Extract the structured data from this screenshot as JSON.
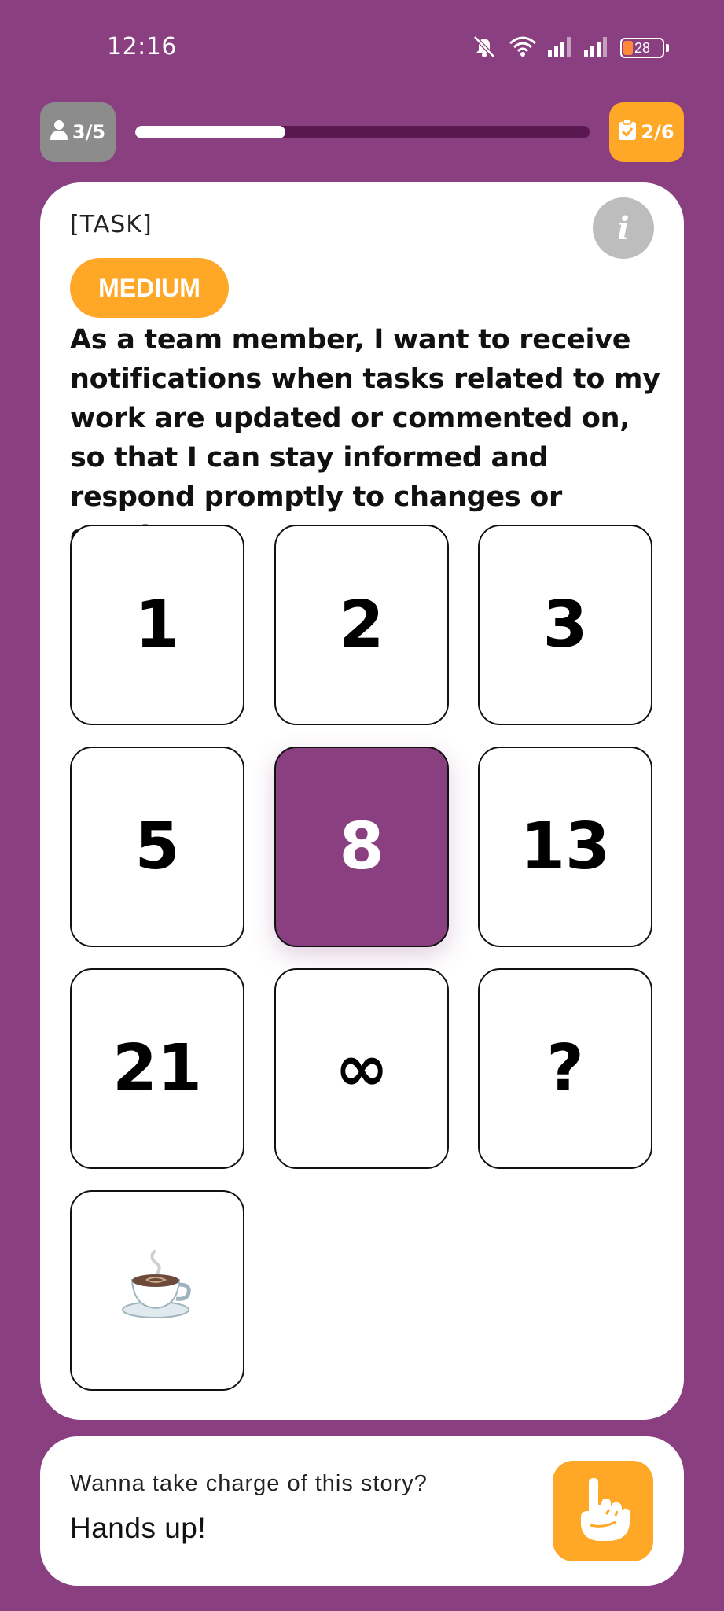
{
  "status_bar": {
    "time": "12:16",
    "battery_level": "28",
    "icons": [
      "mute-icon",
      "wifi-icon",
      "signal-icon",
      "signal-icon",
      "battery-icon"
    ]
  },
  "progress": {
    "players_label": "3/5",
    "tasks_label": "2/6",
    "fill_fraction": 0.33
  },
  "task": {
    "label": "[TASK]",
    "difficulty": "MEDIUM",
    "story": "As a team member, I want to receive notifications when tasks related to my work are updated or commented on, so that I can stay informed and respond promptly to changes or queries."
  },
  "cards": [
    {
      "value": "1",
      "selected": false
    },
    {
      "value": "2",
      "selected": false
    },
    {
      "value": "3",
      "selected": false
    },
    {
      "value": "5",
      "selected": false
    },
    {
      "value": "8",
      "selected": true
    },
    {
      "value": "13",
      "selected": false
    },
    {
      "value": "21",
      "selected": false
    },
    {
      "value": "∞",
      "selected": false
    },
    {
      "value": "?",
      "selected": false
    },
    {
      "value": "☕",
      "selected": false
    }
  ],
  "take_charge": {
    "prompt": "Wanna take charge of this story?",
    "cta": "Hands up!"
  },
  "colors": {
    "background": "#8a3f80",
    "accent": "#ffa726",
    "track": "#5a1850",
    "gray_pill": "#8c8c8c"
  }
}
